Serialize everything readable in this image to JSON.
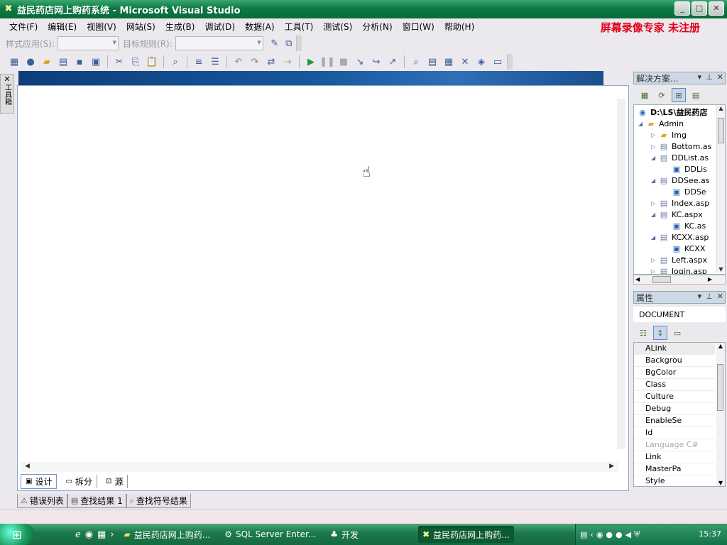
{
  "window": {
    "title": "益民药店网上购药系统 - Microsoft Visual Studio",
    "minimize": "_",
    "maximize": "□",
    "close": "✕"
  },
  "watermark": "屏幕录像专家  未注册",
  "menu": [
    "文件(F)",
    "编辑(E)",
    "视图(V)",
    "网站(S)",
    "生成(B)",
    "调试(D)",
    "数据(A)",
    "工具(T)",
    "测试(S)",
    "分析(N)",
    "窗口(W)",
    "帮助(H)"
  ],
  "toolbar1": {
    "style_label": "样式应用(S):",
    "target_label": "目标规则(R):"
  },
  "toolbox_strip": {
    "label": "工具箱"
  },
  "editor": {
    "view_tabs": [
      "设计",
      "拆分",
      "源"
    ]
  },
  "bottom_tabs": [
    "错误列表",
    "查找结果 1",
    "查找符号结果"
  ],
  "solution_explorer": {
    "title": "解决方案...",
    "tree": [
      {
        "label": "D:\\LS\\益民药店",
        "depth": 0,
        "type": "web"
      },
      {
        "label": "Admin",
        "depth": 1,
        "type": "folder"
      },
      {
        "label": "Img",
        "depth": 2,
        "type": "folder"
      },
      {
        "label": "Bottom.as",
        "depth": 2,
        "type": "page"
      },
      {
        "label": "DDList.as",
        "depth": 2,
        "type": "page"
      },
      {
        "label": "DDLis",
        "depth": 3,
        "type": "cs"
      },
      {
        "label": "DDSee.as",
        "depth": 2,
        "type": "page"
      },
      {
        "label": "DDSe",
        "depth": 3,
        "type": "cs"
      },
      {
        "label": "Index.asp",
        "depth": 2,
        "type": "page"
      },
      {
        "label": "KC.aspx",
        "depth": 2,
        "type": "page"
      },
      {
        "label": "KC.as",
        "depth": 3,
        "type": "cs"
      },
      {
        "label": "KCXX.asp",
        "depth": 2,
        "type": "page"
      },
      {
        "label": "KCXX",
        "depth": 3,
        "type": "cs"
      },
      {
        "label": "Left.aspx",
        "depth": 2,
        "type": "page"
      },
      {
        "label": "login.asp",
        "depth": 2,
        "type": "page"
      }
    ]
  },
  "properties": {
    "title": "属性",
    "object": "DOCUMENT",
    "rows": [
      "ALink",
      "Backgrou",
      "BgColor",
      "Class",
      "Culture",
      "Debug",
      "EnableSe",
      "Id",
      "Language  C#",
      "Link",
      "MasterPa",
      "Style"
    ]
  },
  "taskbar": {
    "tasks": [
      "益民药店网上购药...",
      "SQL Server Enter...",
      "开发",
      "益民药店网上购药..."
    ],
    "clock": "15:37"
  }
}
